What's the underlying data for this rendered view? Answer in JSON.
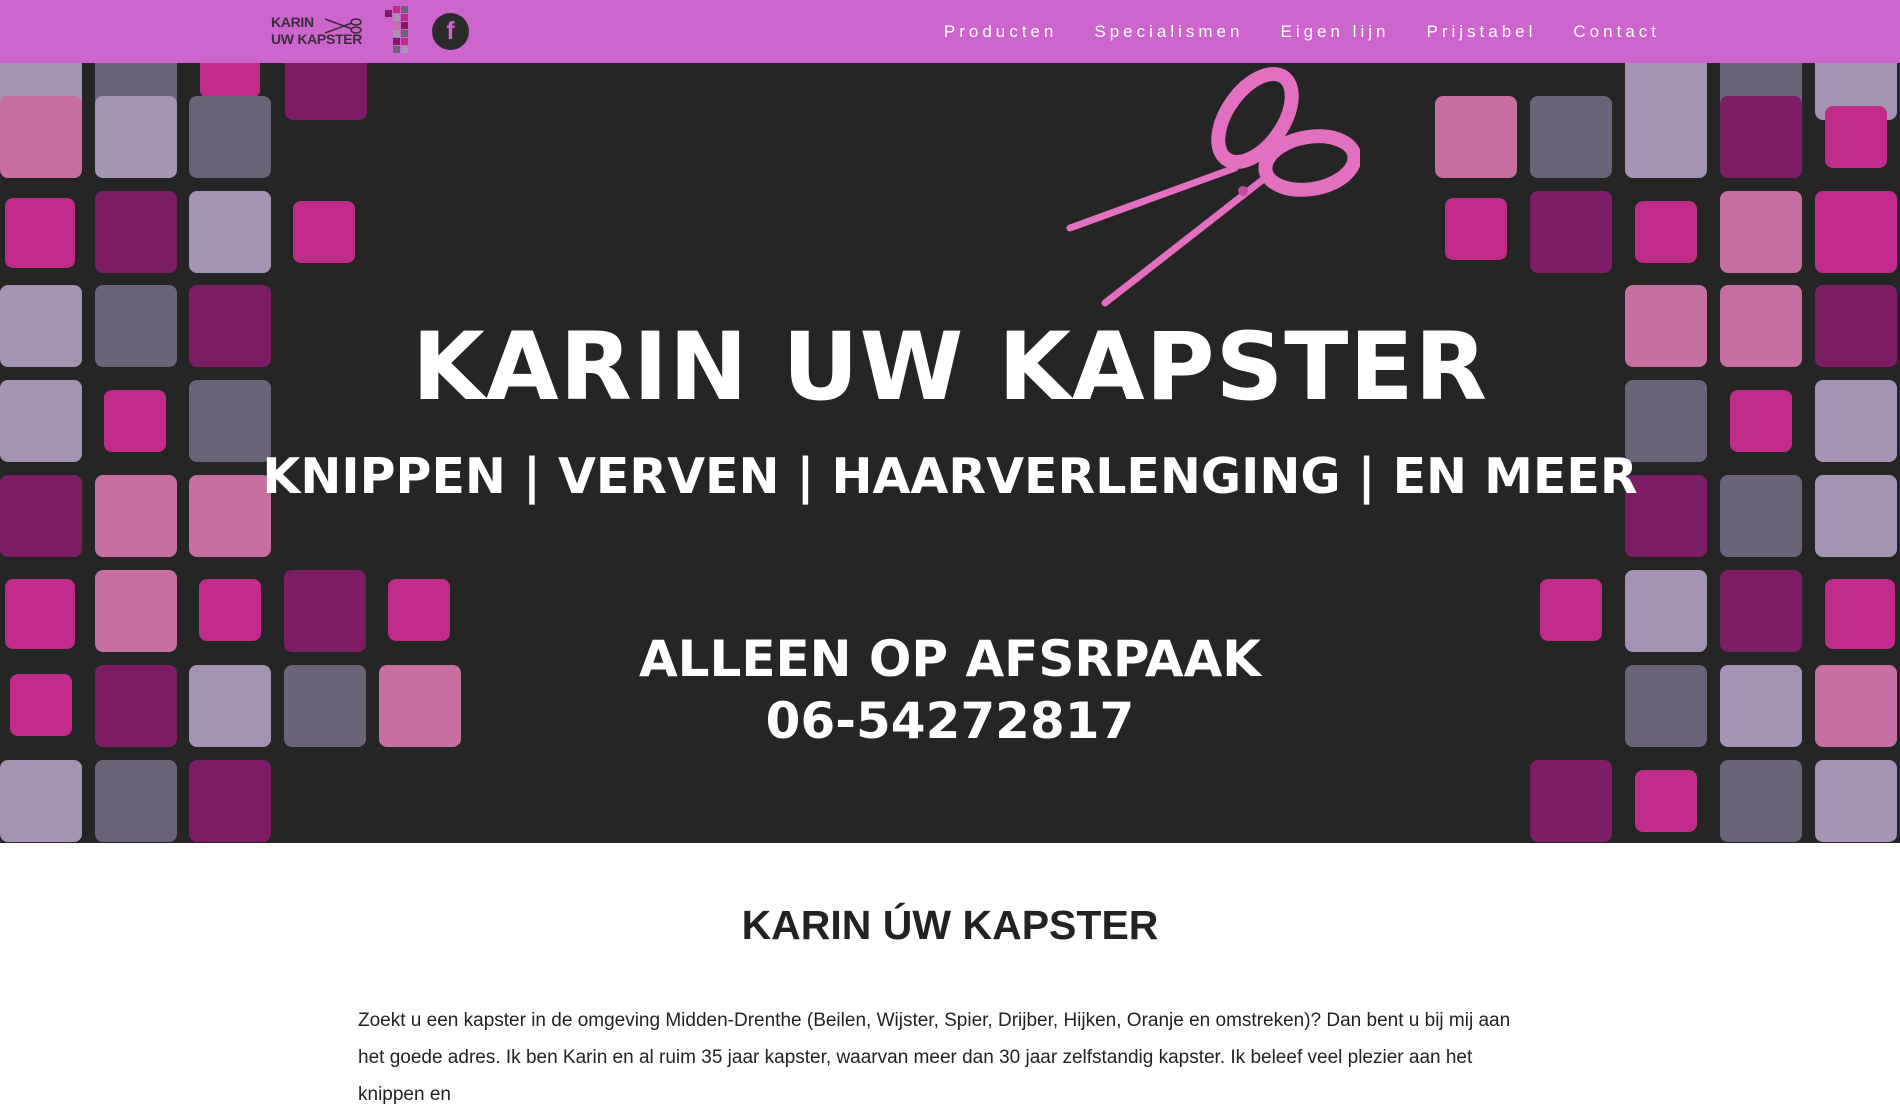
{
  "nav": {
    "logo": {
      "line1": "KARIN",
      "line2": "UW KAPSTER",
      "icon": "scissors-icon"
    },
    "badge_icon": "pixel-number-badge",
    "facebook": {
      "icon": "facebook-icon",
      "glyph": "f"
    },
    "items": [
      {
        "label": "Producten"
      },
      {
        "label": "Specialismen"
      },
      {
        "label": "Eigen lijn"
      },
      {
        "label": "Prijstabel"
      },
      {
        "label": "Contact"
      }
    ]
  },
  "hero": {
    "title": "KARIN UW KAPSTER",
    "subtitle": "KNIPPEN | VERVEN | HAARVERLENGING | EN MEER",
    "cta_line1": "ALLEEN OP AFSRPAAK",
    "cta_line2": "06-54272817",
    "icon": "scissors-icon"
  },
  "content": {
    "title": "KARIN ÚW KAPSTER",
    "paragraph": "Zoekt u een kapster in de omgeving Midden-Drenthe (Beilen, Wijster, Spier, Drijber, Hijken, Oranje en omstreken)? Dan bent u bij mij aan het goede adres. Ik ben Karin en al ruim 35 jaar kapster, waarvan meer dan 30 jaar zelfstandig kapster. Ik beleef veel plezier aan het knippen en"
  },
  "colors": {
    "nav_bg": "#cc66cc",
    "hero_bg": "#252525",
    "tile_magenta": "#c12b8a",
    "tile_pink": "#c66fa0",
    "tile_purple": "#7c1d66",
    "tile_lilac": "#a394b3",
    "tile_gray": "#6b6378",
    "scissors": "#e36fc0"
  }
}
